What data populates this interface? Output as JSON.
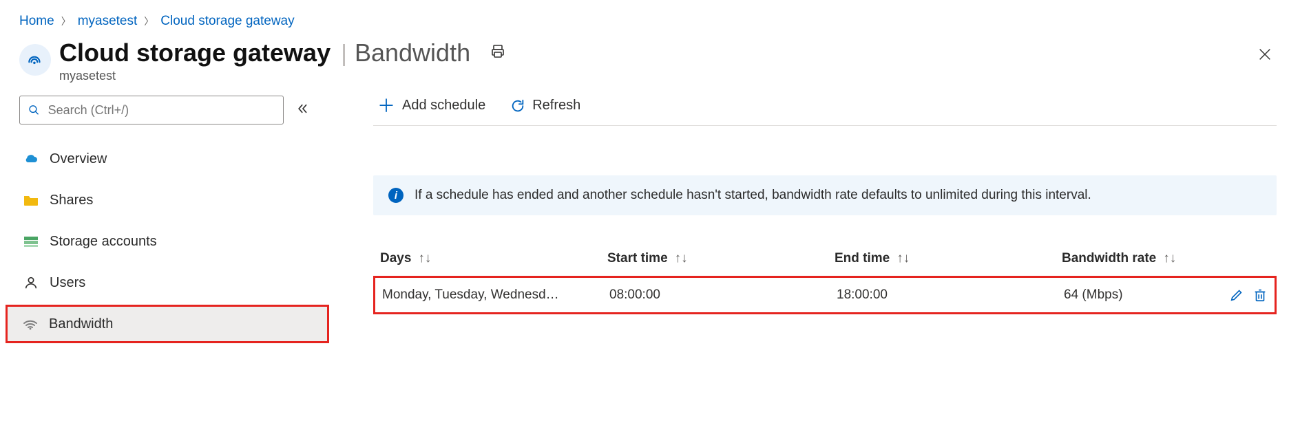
{
  "breadcrumb": {
    "items": [
      {
        "label": "Home"
      },
      {
        "label": "myasetest"
      },
      {
        "label": "Cloud storage gateway"
      }
    ]
  },
  "header": {
    "title": "Cloud storage gateway",
    "section": "Bandwidth",
    "subtitle": "myasetest"
  },
  "search": {
    "placeholder": "Search (Ctrl+/)"
  },
  "sidebar": {
    "items": [
      {
        "label": "Overview",
        "icon": "cloud"
      },
      {
        "label": "Shares",
        "icon": "folder"
      },
      {
        "label": "Storage accounts",
        "icon": "storage"
      },
      {
        "label": "Users",
        "icon": "user"
      },
      {
        "label": "Bandwidth",
        "icon": "wifi",
        "selected": true
      }
    ]
  },
  "toolbar": {
    "add_label": "Add schedule",
    "refresh_label": "Refresh"
  },
  "info": {
    "message": "If a schedule has ended and another schedule hasn't started, bandwidth rate defaults to unlimited during this interval."
  },
  "table": {
    "columns": [
      {
        "label": "Days"
      },
      {
        "label": "Start time"
      },
      {
        "label": "End time"
      },
      {
        "label": "Bandwidth rate"
      }
    ],
    "rows": [
      {
        "days": "Monday, Tuesday, Wednesd…",
        "start": "08:00:00",
        "end": "18:00:00",
        "rate": "64 (Mbps)"
      }
    ]
  }
}
